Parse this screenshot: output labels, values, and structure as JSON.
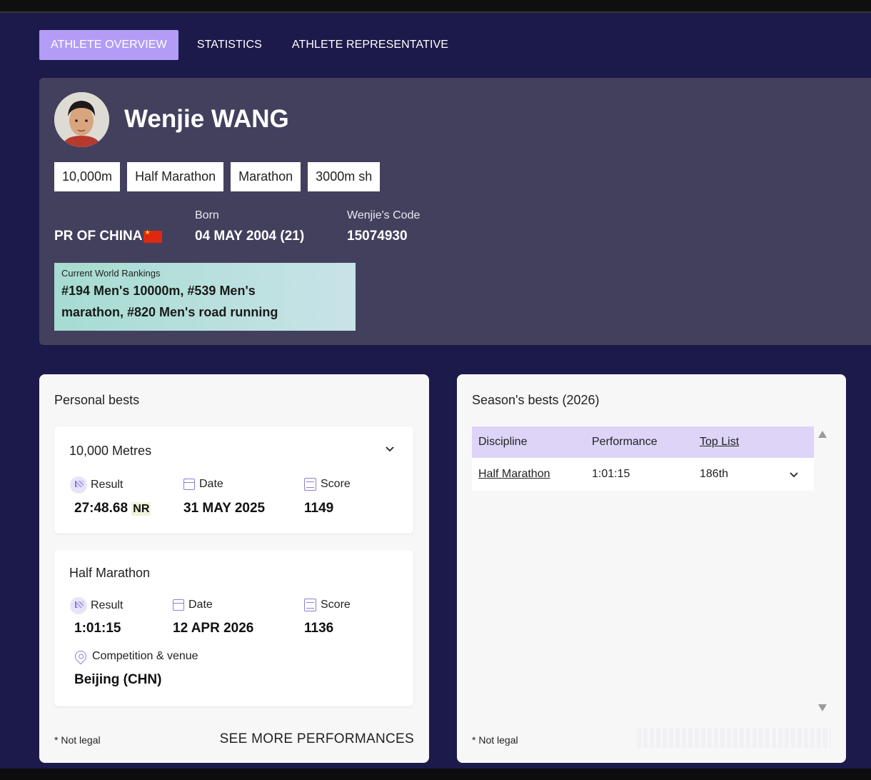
{
  "tabs": [
    {
      "label": "ATHLETE OVERVIEW",
      "active": true
    },
    {
      "label": "STATISTICS",
      "active": false
    },
    {
      "label": "ATHLETE REPRESENTATIVE",
      "active": false
    }
  ],
  "athlete": {
    "name": "Wenjie WANG",
    "disciplines": [
      "10,000m",
      "Half Marathon",
      "Marathon",
      "3000m sh"
    ],
    "country": "PR OF CHINA",
    "born_label": "Born",
    "born_value": "04 MAY 2004 (21)",
    "code_label": "Wenjie's Code",
    "code_value": "15074930",
    "rankings_label": "Current World Rankings",
    "rankings_line1": "#194 Men's 10000m, #539 Men's",
    "rankings_line2": "marathon, #820 Men's road running"
  },
  "personal_bests": {
    "title": "Personal bests",
    "items": [
      {
        "event": "10,000 Metres",
        "result_label": "Result",
        "result": "27:48.68",
        "badge": "NR",
        "date_label": "Date",
        "date": "31 MAY 2025",
        "score_label": "Score",
        "score": "1149"
      },
      {
        "event": "Half Marathon",
        "result_label": "Result",
        "result": "1:01:15",
        "date_label": "Date",
        "date": "12 APR 2026",
        "score_label": "Score",
        "score": "1136",
        "venue_label": "Competition & venue",
        "venue": "Beijing (CHN)"
      }
    ],
    "footnote": "* Not legal",
    "see_more": "SEE MORE PERFORMANCES"
  },
  "season_bests": {
    "title": "Season's bests (2026)",
    "headers": [
      "Discipline",
      "Performance",
      "Top List"
    ],
    "rows": [
      {
        "discipline": "Half Marathon",
        "performance": "1:01:15",
        "top_list": "186th"
      }
    ],
    "footnote": "* Not legal"
  },
  "icons": {
    "chevron": "chevron-down-icon",
    "result": "flag-icon",
    "date": "calendar-icon",
    "score": "score-icon",
    "venue": "location-pin-icon"
  },
  "colors": {
    "background": "#1c1a4a",
    "profile_card": "#43405e",
    "accent": "#b39cf6",
    "table_header": "#ddd4f8"
  }
}
